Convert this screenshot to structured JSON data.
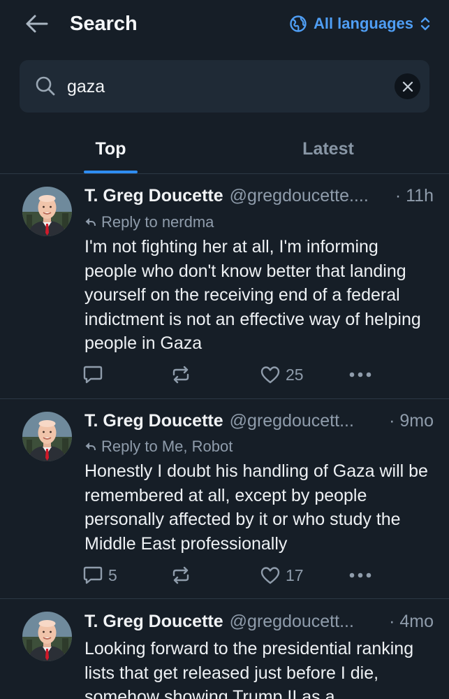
{
  "header": {
    "title": "Search",
    "language_label": "All languages"
  },
  "search": {
    "value": "gaza"
  },
  "tabs": [
    {
      "label": "Top",
      "active": true
    },
    {
      "label": "Latest",
      "active": false
    }
  ],
  "posts": [
    {
      "author": "T. Greg Doucette",
      "handle": "@gregdoucette....",
      "time": "· 11h",
      "reply_to": "Reply to nerdma",
      "text": "I'm not fighting her at all, I'm informing people who don't know better that landing yourself on the receiving end of a federal indictment is not an effective way of helping people in Gaza",
      "replies": "",
      "reposts": "",
      "likes": "25"
    },
    {
      "author": "T. Greg Doucette",
      "handle": "@gregdoucett...",
      "time": "· 9mo",
      "reply_to": "Reply to Me, Robot",
      "text": "Honestly I doubt his handling of Gaza will be remembered at all, except by people personally affected by it or who study the Middle East professionally",
      "replies": "5",
      "reposts": "",
      "likes": "17"
    },
    {
      "author": "T. Greg Doucette",
      "handle": "@gregdoucett...",
      "time": "· 4mo",
      "reply_to": "",
      "text": "Looking forward to the presidential ranking lists that get released just before I die, somehow showing Trump II as a",
      "replies": "",
      "reposts": "",
      "likes": ""
    }
  ],
  "colors": {
    "background": "#161e27",
    "accent": "#2f8df2",
    "link": "#4f9ef4",
    "muted": "#8f9cab"
  }
}
